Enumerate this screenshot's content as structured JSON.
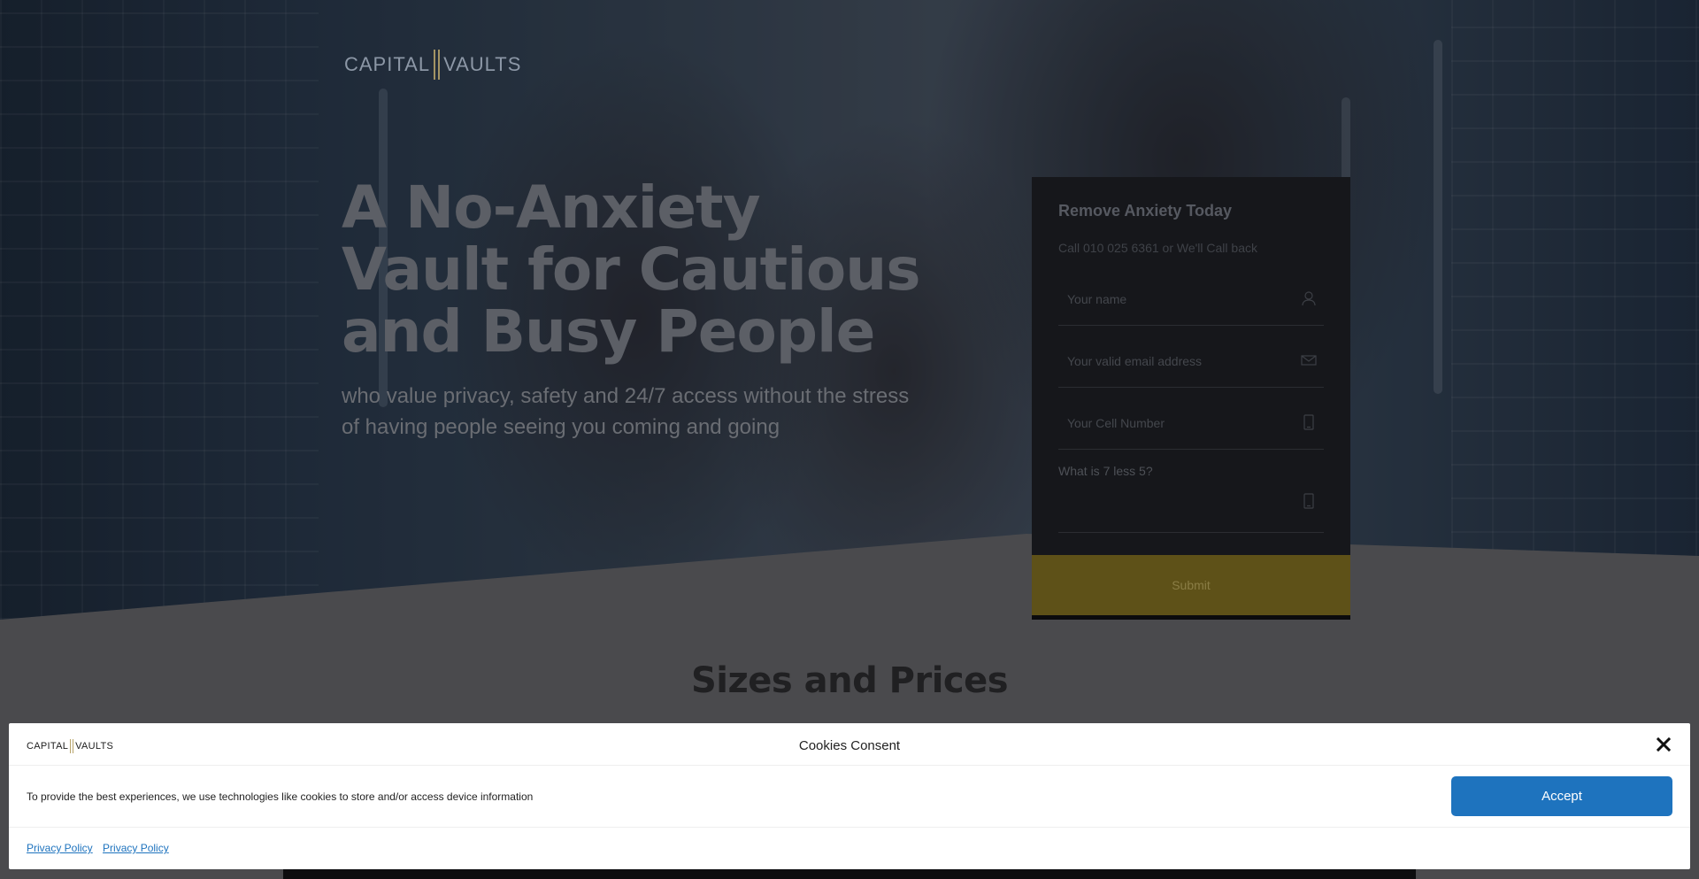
{
  "brand": {
    "name_left": "CAPITAL",
    "name_right": "VAULTS",
    "accent_gold": "#a39464",
    "submit_color": "#5e5118",
    "accept_blue": "#1e73be"
  },
  "hero": {
    "title": "A No-Anxiety Vault for Cautious and Busy People",
    "subtitle": "who value privacy, safety and 24/7 access without the stress of having people seeing you coming and going"
  },
  "form": {
    "title": "Remove Anxiety Today",
    "call_text": "Call 010 025 6361 or We'll Call back",
    "name_placeholder": "Your name",
    "email_placeholder": "Your valid email address",
    "cell_placeholder": "Your Cell Number",
    "captcha_label": "What is 7 less 5?",
    "submit_label": "Submit",
    "icons": [
      "user-icon",
      "envelope-icon",
      "phone-icon",
      "phone-icon"
    ]
  },
  "sizes": {
    "title": "Sizes and Prices"
  },
  "cookie": {
    "logo_left": "CAPITAL",
    "logo_right": "VAULTS",
    "title": "Cookies Consent",
    "text": "To provide the best experiences, we use technologies like cookies to store and/or access device information",
    "accept_label": "Accept",
    "links": [
      "Privacy Policy",
      "Privacy Policy"
    ]
  }
}
